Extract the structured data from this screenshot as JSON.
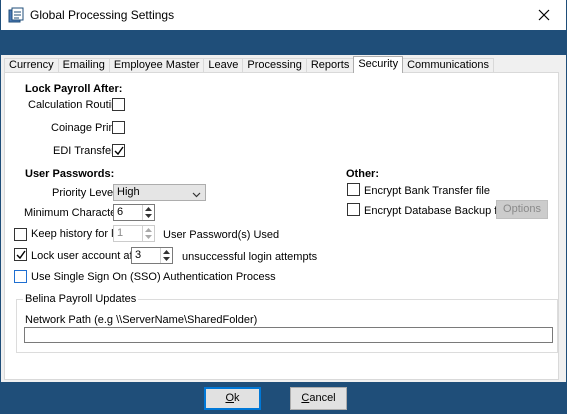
{
  "window": {
    "title": "Global Processing Settings"
  },
  "tabs": [
    {
      "label": "Currency",
      "active": false
    },
    {
      "label": "Emailing",
      "active": false
    },
    {
      "label": "Employee Master",
      "active": false
    },
    {
      "label": "Leave",
      "active": false
    },
    {
      "label": "Processing",
      "active": false
    },
    {
      "label": "Reports",
      "active": false
    },
    {
      "label": "Security",
      "active": true
    },
    {
      "label": "Communications",
      "active": false
    }
  ],
  "lock_payroll": {
    "heading": "Lock Payroll After:",
    "calculation_routine": {
      "label": "Calculation Routine",
      "checked": false
    },
    "coinage_print": {
      "label": "Coinage Print",
      "checked": false
    },
    "edi_transfer": {
      "label": "EDI Transfer",
      "checked": true
    }
  },
  "user_passwords": {
    "heading": "User Passwords:",
    "priority_level_label": "Priority Level:",
    "priority_level_value": "High",
    "minimum_characters_label": "Minimum Characters:",
    "minimum_characters_value": "6",
    "keep_history": {
      "label": "Keep history for last",
      "checked": false,
      "value": "1",
      "suffix": "User Password(s) Used"
    },
    "lock_account": {
      "label": "Lock user account after",
      "checked": true,
      "value": "3",
      "suffix": "unsuccessful login attempts"
    },
    "sso": {
      "label": "Use Single Sign On (SSO) Authentication Process",
      "checked": false
    }
  },
  "other": {
    "heading": "Other:",
    "encrypt_bank": {
      "label": "Encrypt Bank Transfer file",
      "checked": false
    },
    "encrypt_db": {
      "label": "Encrypt Database Backup file",
      "checked": false
    },
    "options_button": "Options"
  },
  "updates": {
    "group_title": "Belina Payroll Updates",
    "network_path_label": "Network Path (e.g \\\\ServerName\\SharedFolder)",
    "network_path_value": ""
  },
  "buttons": {
    "ok_prefix": "O",
    "ok_rest": "k",
    "cancel_prefix": "C",
    "cancel_rest": "ancel"
  },
  "colors": {
    "accent_bar": "#1f4e79",
    "default_button_border": "#0078d7"
  }
}
